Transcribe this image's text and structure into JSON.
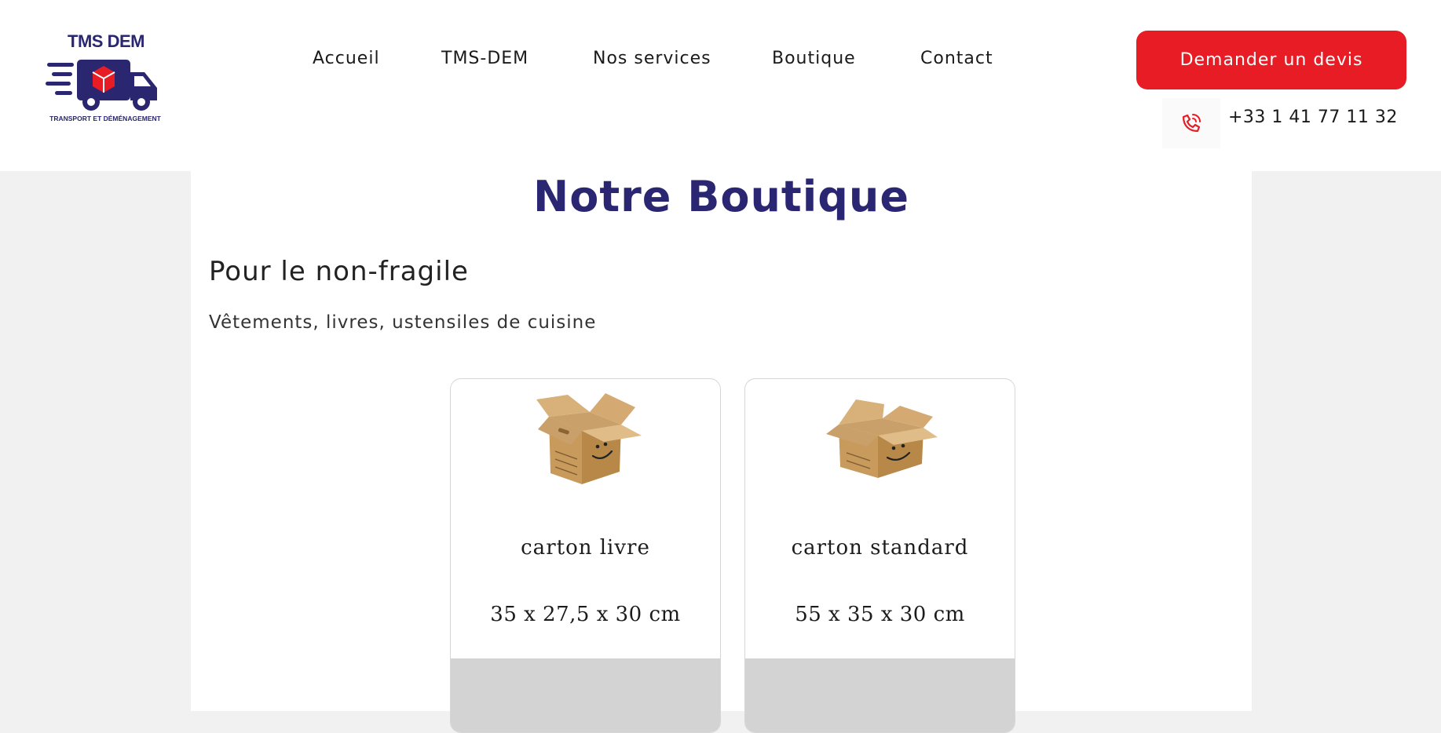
{
  "brand": {
    "name": "TMS DEM",
    "tagline": "TRANSPORT ET DÉMÉNAGEMENT",
    "colors": {
      "primary": "#2a2672",
      "accent": "#e81c25"
    }
  },
  "nav": {
    "items": [
      {
        "label": "Accueil"
      },
      {
        "label": "TMS-DEM"
      },
      {
        "label": "Nos services"
      },
      {
        "label": "Boutique"
      },
      {
        "label": "Contact"
      }
    ]
  },
  "header": {
    "cta_label": "Demander un devis",
    "phone_icon": "phone-icon",
    "phone_number": "+33 1 41 77 11 32"
  },
  "main": {
    "title": "Notre Boutique",
    "section_title": "Pour le non-fragile",
    "section_desc": "Vêtements, livres, ustensiles de cuisine",
    "products": [
      {
        "name": "carton livre",
        "dimensions": "35 x 27,5 x 30 cm",
        "image": "cardboard-box-image"
      },
      {
        "name": "carton standard",
        "dimensions": "55 x 35 x 30 cm",
        "image": "cardboard-box-image"
      }
    ]
  }
}
